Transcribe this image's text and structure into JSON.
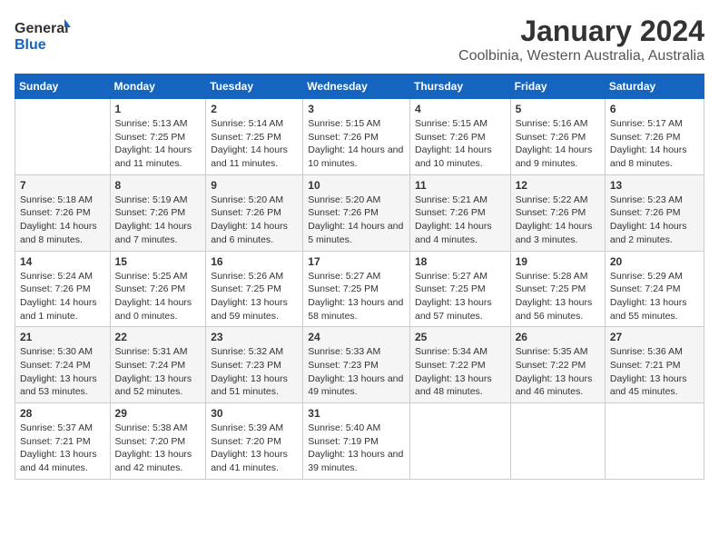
{
  "logo": {
    "line1": "General",
    "line2": "Blue"
  },
  "title": "January 2024",
  "subtitle": "Coolbinia, Western Australia, Australia",
  "days_of_week": [
    "Sunday",
    "Monday",
    "Tuesday",
    "Wednesday",
    "Thursday",
    "Friday",
    "Saturday"
  ],
  "weeks": [
    [
      {
        "num": "",
        "sunrise": "",
        "sunset": "",
        "daylight": ""
      },
      {
        "num": "1",
        "sunrise": "5:13 AM",
        "sunset": "7:25 PM",
        "daylight": "14 hours and 11 minutes."
      },
      {
        "num": "2",
        "sunrise": "5:14 AM",
        "sunset": "7:25 PM",
        "daylight": "14 hours and 11 minutes."
      },
      {
        "num": "3",
        "sunrise": "5:15 AM",
        "sunset": "7:26 PM",
        "daylight": "14 hours and 10 minutes."
      },
      {
        "num": "4",
        "sunrise": "5:15 AM",
        "sunset": "7:26 PM",
        "daylight": "14 hours and 10 minutes."
      },
      {
        "num": "5",
        "sunrise": "5:16 AM",
        "sunset": "7:26 PM",
        "daylight": "14 hours and 9 minutes."
      },
      {
        "num": "6",
        "sunrise": "5:17 AM",
        "sunset": "7:26 PM",
        "daylight": "14 hours and 8 minutes."
      }
    ],
    [
      {
        "num": "7",
        "sunrise": "5:18 AM",
        "sunset": "7:26 PM",
        "daylight": "14 hours and 8 minutes."
      },
      {
        "num": "8",
        "sunrise": "5:19 AM",
        "sunset": "7:26 PM",
        "daylight": "14 hours and 7 minutes."
      },
      {
        "num": "9",
        "sunrise": "5:20 AM",
        "sunset": "7:26 PM",
        "daylight": "14 hours and 6 minutes."
      },
      {
        "num": "10",
        "sunrise": "5:20 AM",
        "sunset": "7:26 PM",
        "daylight": "14 hours and 5 minutes."
      },
      {
        "num": "11",
        "sunrise": "5:21 AM",
        "sunset": "7:26 PM",
        "daylight": "14 hours and 4 minutes."
      },
      {
        "num": "12",
        "sunrise": "5:22 AM",
        "sunset": "7:26 PM",
        "daylight": "14 hours and 3 minutes."
      },
      {
        "num": "13",
        "sunrise": "5:23 AM",
        "sunset": "7:26 PM",
        "daylight": "14 hours and 2 minutes."
      }
    ],
    [
      {
        "num": "14",
        "sunrise": "5:24 AM",
        "sunset": "7:26 PM",
        "daylight": "14 hours and 1 minute."
      },
      {
        "num": "15",
        "sunrise": "5:25 AM",
        "sunset": "7:26 PM",
        "daylight": "14 hours and 0 minutes."
      },
      {
        "num": "16",
        "sunrise": "5:26 AM",
        "sunset": "7:25 PM",
        "daylight": "13 hours and 59 minutes."
      },
      {
        "num": "17",
        "sunrise": "5:27 AM",
        "sunset": "7:25 PM",
        "daylight": "13 hours and 58 minutes."
      },
      {
        "num": "18",
        "sunrise": "5:27 AM",
        "sunset": "7:25 PM",
        "daylight": "13 hours and 57 minutes."
      },
      {
        "num": "19",
        "sunrise": "5:28 AM",
        "sunset": "7:25 PM",
        "daylight": "13 hours and 56 minutes."
      },
      {
        "num": "20",
        "sunrise": "5:29 AM",
        "sunset": "7:24 PM",
        "daylight": "13 hours and 55 minutes."
      }
    ],
    [
      {
        "num": "21",
        "sunrise": "5:30 AM",
        "sunset": "7:24 PM",
        "daylight": "13 hours and 53 minutes."
      },
      {
        "num": "22",
        "sunrise": "5:31 AM",
        "sunset": "7:24 PM",
        "daylight": "13 hours and 52 minutes."
      },
      {
        "num": "23",
        "sunrise": "5:32 AM",
        "sunset": "7:23 PM",
        "daylight": "13 hours and 51 minutes."
      },
      {
        "num": "24",
        "sunrise": "5:33 AM",
        "sunset": "7:23 PM",
        "daylight": "13 hours and 49 minutes."
      },
      {
        "num": "25",
        "sunrise": "5:34 AM",
        "sunset": "7:22 PM",
        "daylight": "13 hours and 48 minutes."
      },
      {
        "num": "26",
        "sunrise": "5:35 AM",
        "sunset": "7:22 PM",
        "daylight": "13 hours and 46 minutes."
      },
      {
        "num": "27",
        "sunrise": "5:36 AM",
        "sunset": "7:21 PM",
        "daylight": "13 hours and 45 minutes."
      }
    ],
    [
      {
        "num": "28",
        "sunrise": "5:37 AM",
        "sunset": "7:21 PM",
        "daylight": "13 hours and 44 minutes."
      },
      {
        "num": "29",
        "sunrise": "5:38 AM",
        "sunset": "7:20 PM",
        "daylight": "13 hours and 42 minutes."
      },
      {
        "num": "30",
        "sunrise": "5:39 AM",
        "sunset": "7:20 PM",
        "daylight": "13 hours and 41 minutes."
      },
      {
        "num": "31",
        "sunrise": "5:40 AM",
        "sunset": "7:19 PM",
        "daylight": "13 hours and 39 minutes."
      },
      {
        "num": "",
        "sunrise": "",
        "sunset": "",
        "daylight": ""
      },
      {
        "num": "",
        "sunrise": "",
        "sunset": "",
        "daylight": ""
      },
      {
        "num": "",
        "sunrise": "",
        "sunset": "",
        "daylight": ""
      }
    ]
  ],
  "labels": {
    "sunrise": "Sunrise:",
    "sunset": "Sunset:",
    "daylight": "Daylight: "
  }
}
